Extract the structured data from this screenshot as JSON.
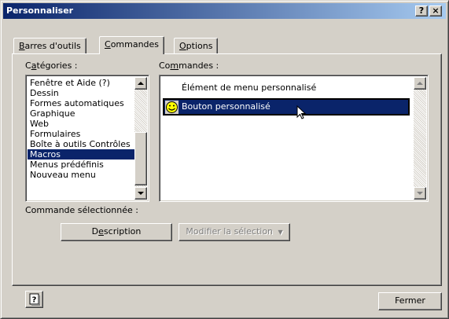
{
  "window": {
    "title": "Personnaliser",
    "help_glyph": "?",
    "close_glyph": "×"
  },
  "tabs": [
    {
      "label_pre": "",
      "label_u": "B",
      "label_post": "arres d'outils"
    },
    {
      "label_pre": "",
      "label_u": "C",
      "label_post": "ommandes"
    },
    {
      "label_pre": "",
      "label_u": "O",
      "label_post": "ptions"
    }
  ],
  "categories": {
    "label_pre": "C",
    "label_u": "a",
    "label_post": "tégories :",
    "items": [
      "Fenêtre et Aide (?)",
      "Dessin",
      "Formes automatiques",
      "Graphique",
      "Web",
      "Formulaires",
      "Boîte à outils Contrôles",
      "Macros",
      "Menus prédéfinis",
      "Nouveau menu"
    ],
    "selected": "Macros"
  },
  "commands": {
    "label_pre": "Co",
    "label_u": "m",
    "label_post": "mandes :",
    "items": [
      {
        "label": "Élément de menu personnalisé",
        "icon": "none"
      },
      {
        "label": "Bouton personnalisé",
        "icon": "smiley-icon"
      }
    ],
    "selected": "Bouton personnalisé"
  },
  "selected_command_label": "Commande sélectionnée :",
  "buttons": {
    "description_pre": "D",
    "description_u": "e",
    "description_post": "scription",
    "modify_label": "Modifier la sélection",
    "close_label": "Fermer"
  },
  "colors": {
    "title_start": "#0a246a",
    "title_end": "#a6caf0",
    "selection": "#0a246a",
    "face": "#d4d0c8"
  }
}
